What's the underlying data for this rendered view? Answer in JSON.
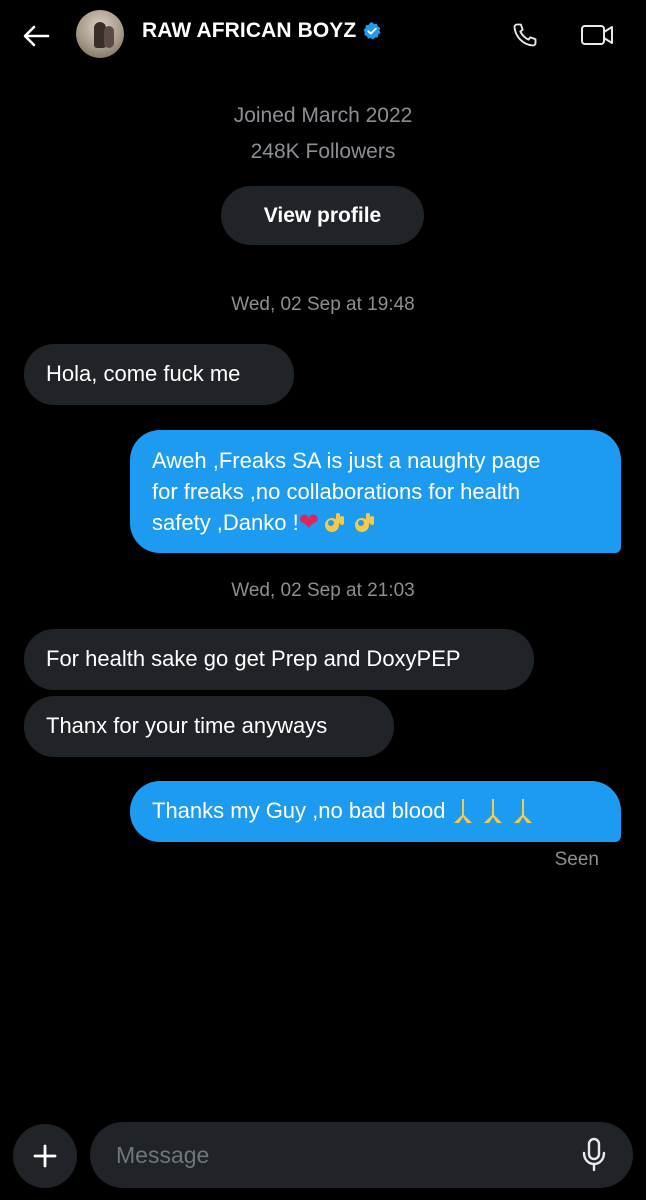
{
  "header": {
    "title": "RAW AFRICAN BOYZ",
    "back_icon": "arrow-left-icon",
    "verified_icon": "verified-badge-icon",
    "call_icon": "phone-icon",
    "video_icon": "video-camera-icon"
  },
  "profile": {
    "joined": "Joined March 2022",
    "followers": "248K Followers",
    "view_profile_label": "View profile"
  },
  "conversation": {
    "timestamp_1": "Wed, 02 Sep at 19:48",
    "msg_1": "Hola, come fuck me",
    "msg_2_line_1": "Aweh ,Freaks SA is just a naughty page",
    "msg_2_line_2": "for freaks ,no collaborations for health",
    "msg_2_line_3": "safety ,Danko ! ",
    "timestamp_2": "Wed, 02 Sep at 21:03",
    "msg_3": "For health sake go get Prep and DoxyPEP",
    "msg_4": "Thanx for your time anyways",
    "msg_5": "Thanks my Guy ,no bad blood ",
    "seen": "Seen"
  },
  "composer": {
    "placeholder": "Message",
    "add_icon": "plus-icon",
    "mic_icon": "microphone-icon"
  },
  "colors": {
    "background": "#000000",
    "incoming_bubble": "#202327",
    "outgoing_bubble": "#1d9bf0",
    "muted_text": "#8b8f94",
    "verified": "#1d9bf0"
  }
}
